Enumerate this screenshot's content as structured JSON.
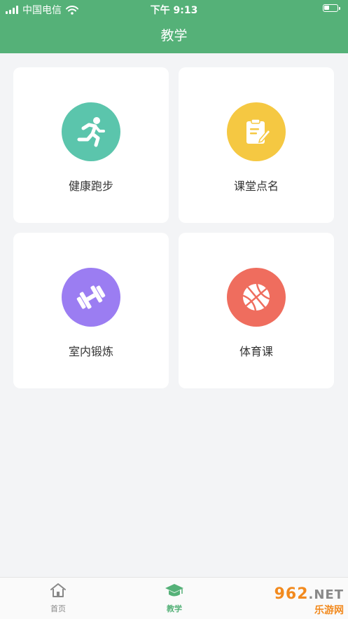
{
  "status_bar": {
    "carrier": "中国电信",
    "time": "下午 9:13"
  },
  "header": {
    "title": "教学"
  },
  "cards": [
    {
      "label": "健康跑步",
      "icon": "running-man-icon",
      "color": "#5bc5ac"
    },
    {
      "label": "课堂点名",
      "icon": "clipboard-edit-icon",
      "color": "#f5c842"
    },
    {
      "label": "室内锻炼",
      "icon": "dumbbell-icon",
      "color": "#9b7df2"
    },
    {
      "label": "体育课",
      "icon": "basketball-icon",
      "color": "#ef6d5e"
    }
  ],
  "tabbar": {
    "tabs": [
      {
        "label": "首页",
        "icon": "home-icon",
        "active": false
      },
      {
        "label": "教学",
        "icon": "graduation-cap-icon",
        "active": true
      }
    ],
    "active_color": "#55b178",
    "inactive_color": "#888888"
  },
  "watermark": {
    "brand": "962",
    "suffix": ".NET",
    "sub": "乐游网"
  }
}
